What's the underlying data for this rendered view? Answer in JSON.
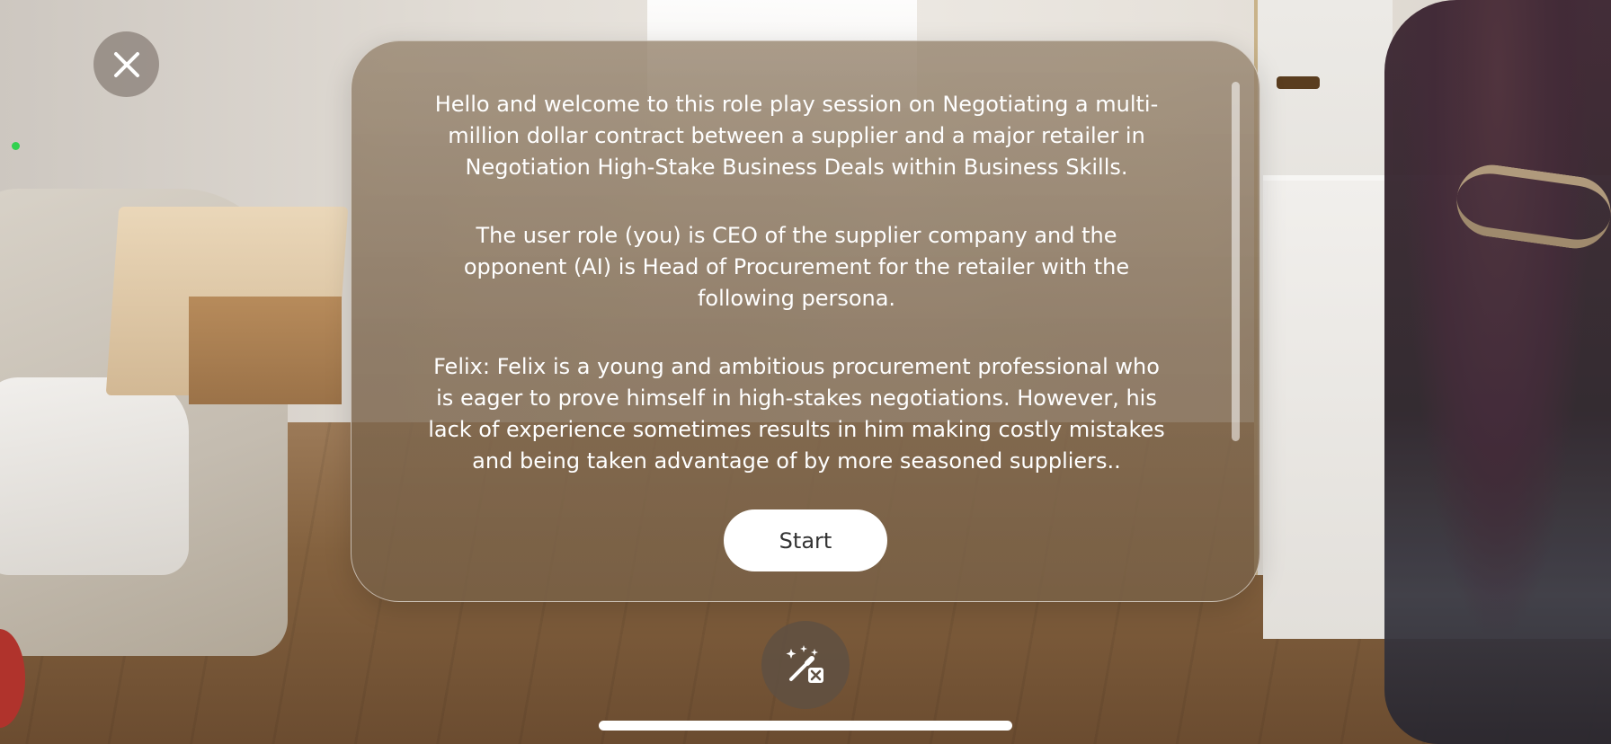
{
  "session": {
    "intro_paragraph": "Hello and welcome to this role play session on Negotiating a multi-million dollar contract between a supplier and a major retailer in Negotiation High-Stake Business Deals within Business Skills.",
    "roles_paragraph": "The user role (you) is CEO of the supplier company and the opponent (AI) is Head of Procurement for the retailer with the following persona.",
    "persona_paragraph": "Felix: Felix is a young and ambitious procurement professional who is eager to prove himself in high-stakes negotiations. However, his lack of experience sometimes results in him making costly mistakes and being taken advantage of by more seasoned suppliers.."
  },
  "actions": {
    "start_label": "Start"
  },
  "icons": {
    "close": "close-icon",
    "magic": "magic-wand-off-icon"
  },
  "colors": {
    "status_dot": "#31d14f",
    "panel_tint": "#8a7258"
  }
}
